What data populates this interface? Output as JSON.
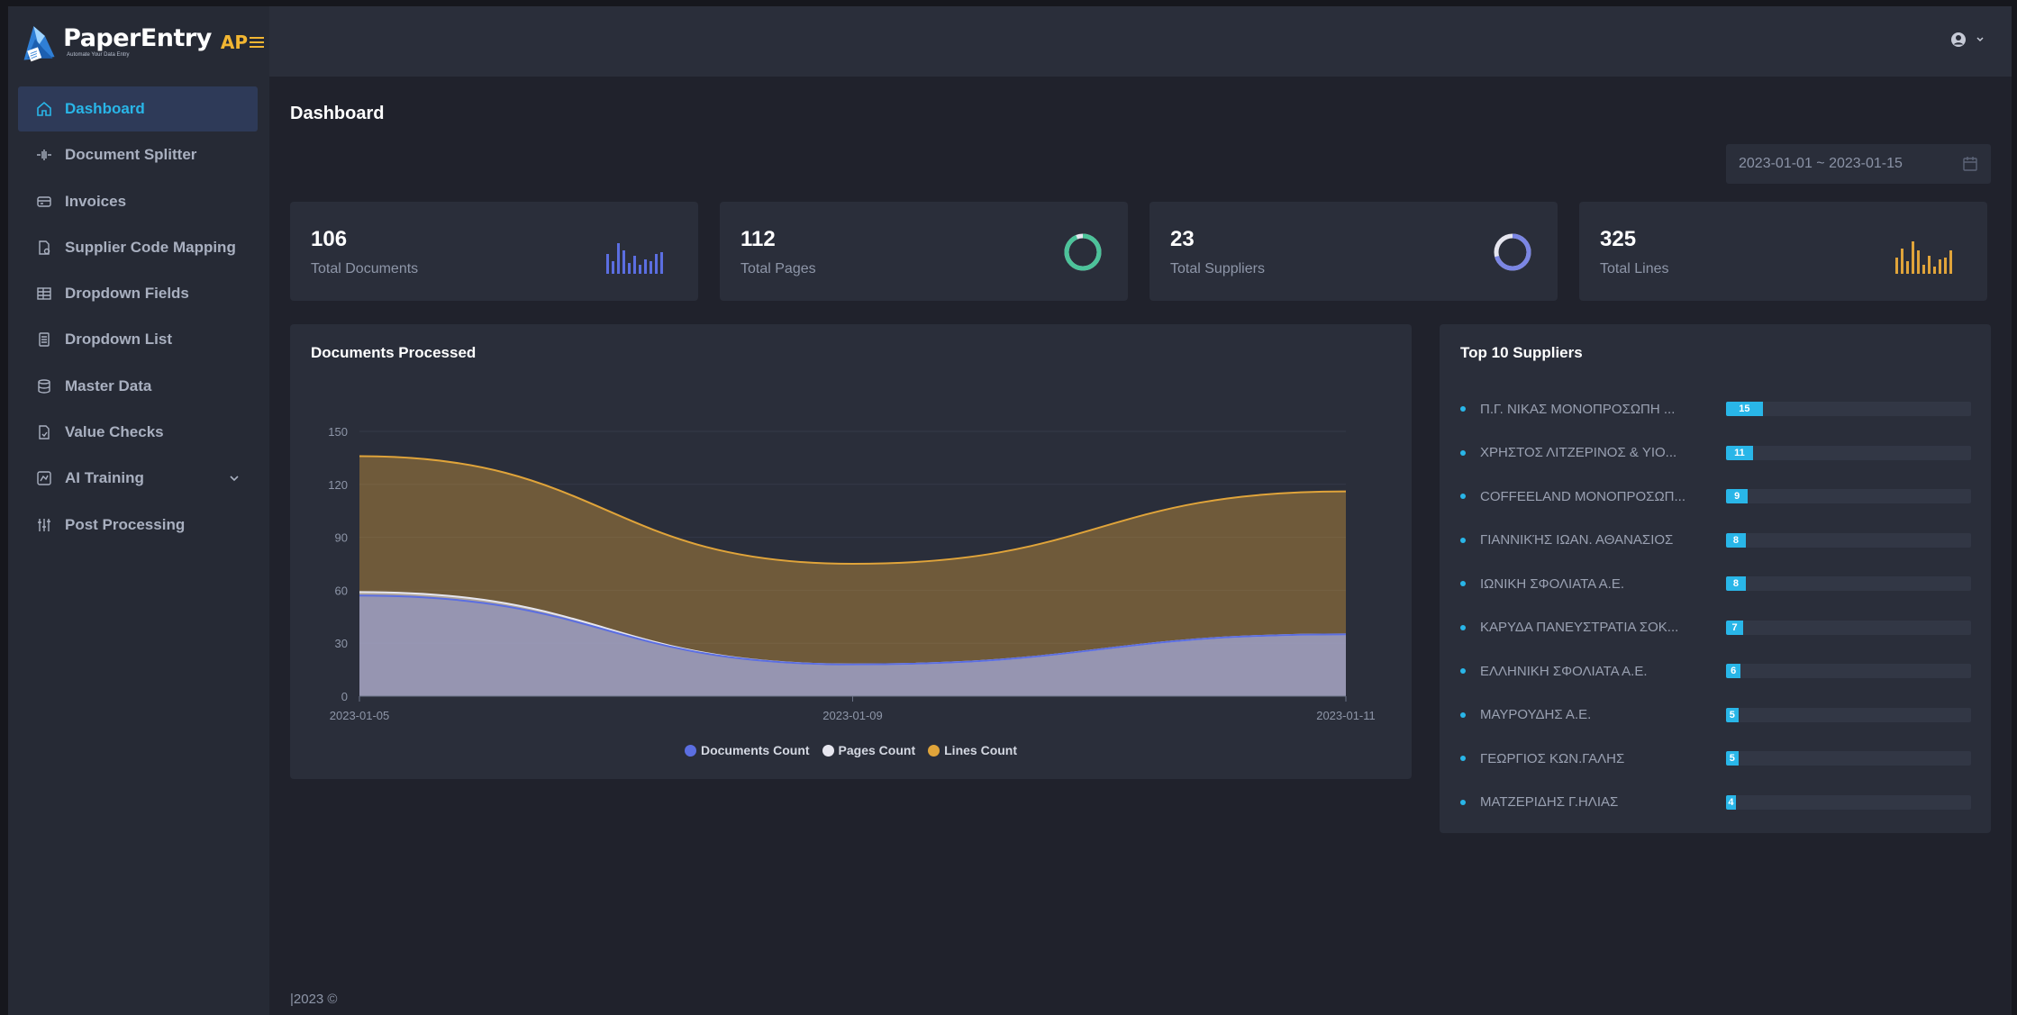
{
  "brand": {
    "name": "PaperEntry",
    "tagline": "Automate Your Data Entry",
    "badge": "AP"
  },
  "sidebar": {
    "items": [
      {
        "label": "Dashboard",
        "icon": "home-icon",
        "active": true
      },
      {
        "label": "Document Splitter",
        "icon": "splitter-icon"
      },
      {
        "label": "Invoices",
        "icon": "invoice-icon"
      },
      {
        "label": "Supplier Code Mapping",
        "icon": "mapping-icon"
      },
      {
        "label": "Dropdown Fields",
        "icon": "table-icon"
      },
      {
        "label": "Dropdown List",
        "icon": "list-icon"
      },
      {
        "label": "Master Data",
        "icon": "database-icon"
      },
      {
        "label": "Value Checks",
        "icon": "check-file-icon"
      },
      {
        "label": "AI Training",
        "icon": "ai-icon",
        "has_submenu": true
      },
      {
        "label": "Post Processing",
        "icon": "sliders-icon"
      }
    ]
  },
  "header": {
    "user_icon": "user-circle-icon"
  },
  "page": {
    "title": "Dashboard"
  },
  "date_range": {
    "value": "2023-01-01 ~ 2023-01-15"
  },
  "stats": [
    {
      "value": "106",
      "label": "Total Documents",
      "graphic": "bars",
      "color": "#5b6ee1"
    },
    {
      "value": "112",
      "label": "Total Pages",
      "graphic": "ring",
      "color": "#4cc39a"
    },
    {
      "value": "23",
      "label": "Total Suppliers",
      "graphic": "ring",
      "color": "#7b86e4"
    },
    {
      "value": "325",
      "label": "Total Lines",
      "graphic": "bars",
      "color": "#e0a43a"
    }
  ],
  "documents_chart": {
    "title": "Documents Processed",
    "chart_data": {
      "type": "area",
      "x": [
        "2023-01-05",
        "2023-01-09",
        "2023-01-11"
      ],
      "ylim": [
        0,
        150
      ],
      "yticks": [
        0,
        30,
        60,
        90,
        120,
        150
      ],
      "series": [
        {
          "name": "Documents Count",
          "color": "#5b6ee1",
          "values": [
            57,
            18,
            35
          ]
        },
        {
          "name": "Pages Count",
          "color": "#e6e6ef",
          "values": [
            59,
            18,
            35
          ]
        },
        {
          "name": "Lines Count",
          "color": "#e0a43a",
          "values": [
            136,
            75,
            116
          ]
        }
      ]
    }
  },
  "top_suppliers": {
    "title": "Top 10 Suppliers",
    "max": 100,
    "items": [
      {
        "name": "Π.Γ. ΝΙΚΑΣ ΜΟΝΟΠΡΟΣΩΠΗ ...",
        "value": 15
      },
      {
        "name": "ΧΡΗΣΤΟΣ ΛΙΤΖΕΡΙΝΟΣ & ΥΙΟ...",
        "value": 11
      },
      {
        "name": "COFFEELAND ΜΟΝΟΠΡΟΣΩΠ...",
        "value": 9
      },
      {
        "name": "ΓΙΑΝΝΙΚΉΣ ΙΩΑΝ. ΑΘΑΝΑΣΙΟΣ",
        "value": 8
      },
      {
        "name": "ΙΩΝΙΚΗ ΣΦΟΛΙΑΤΑ Α.Ε.",
        "value": 8
      },
      {
        "name": "ΚΑΡΥΔΑ ΠΑΝΕΥΣΤΡΑΤΙΑ ΣΟΚ...",
        "value": 7
      },
      {
        "name": "ΕΛΛΗΝΙΚΗ ΣΦΟΛΙΑΤΑ Α.Ε.",
        "value": 6
      },
      {
        "name": "ΜΑΥΡΟΥΔΗΣ Α.Ε.",
        "value": 5
      },
      {
        "name": "ΓΕΩΡΓΙΟΣ ΚΩΝ.ΓΑΛΗΣ",
        "value": 5
      },
      {
        "name": "ΜΑΤΖΕΡΙΔΗΣ Γ.ΗΛΙΑΣ",
        "value": 4
      }
    ]
  },
  "footer": {
    "text": "|2023 ©"
  }
}
